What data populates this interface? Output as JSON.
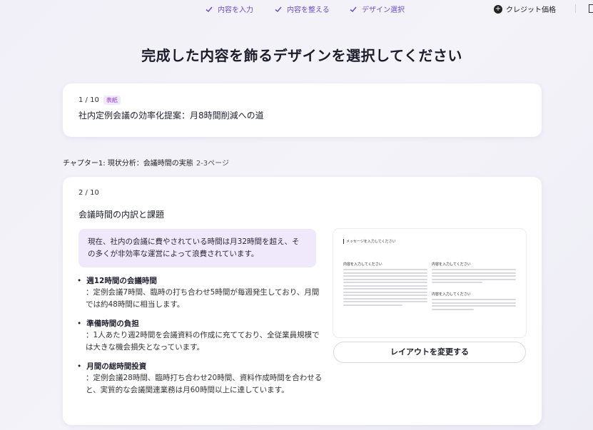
{
  "steps": [
    {
      "label": "内容を入力"
    },
    {
      "label": "内容を整える"
    },
    {
      "label": "デザイン選択"
    }
  ],
  "credit": {
    "label": "クレジット価格"
  },
  "page_title": "完成した内容を飾るデザインを選択してください",
  "slide1": {
    "page": "1 / 10",
    "badge": "表紙",
    "title": "社内定例会議の効率化提案：月8時間削減への道"
  },
  "chapter": {
    "label": "チャプター1: 現状分析：会議時間の実態",
    "pages": "2-3ページ"
  },
  "slide2": {
    "page": "2 / 10",
    "title": "会議時間の内訳と課題",
    "summary": "現在、社内の会議に費やされている時間は月32時間を超え、その多くが非効率な運営によって浪費されています。",
    "bullets": [
      {
        "head": "週12時間の会議時間",
        "body": "：定例会議7時間、臨時の打ち合わせ5時間が毎週発生しており、月間では約48時間に相当します。"
      },
      {
        "head": "準備時間の負担",
        "body": "：1人あたり週2時間を会議資料の作成に充てており、全従業員規模では大きな機会損失となっています。"
      },
      {
        "head": "月間の総時間投資",
        "body": "：定例会議28時間、臨時打ち合わせ20時間、資料作成時間を合わせると、実質的な会議関連業務は月60時間以上に達しています。"
      }
    ],
    "preview": {
      "heading": "メッセージを入力してください",
      "col_heading_1": "内容を入力してください",
      "col_heading_2": "内容を入力してください",
      "col_heading_3": "内容を入力してください"
    },
    "layout_button": "レイアウトを変更する"
  },
  "colors": {
    "accent": "#6a4fd0",
    "badge_text": "#8b3fd8",
    "badge_bg": "#f2e8fd",
    "summary_bg": "#efe9fb"
  },
  "icons": {
    "step_check": "check-icon",
    "credit": "plus-circle-icon"
  }
}
